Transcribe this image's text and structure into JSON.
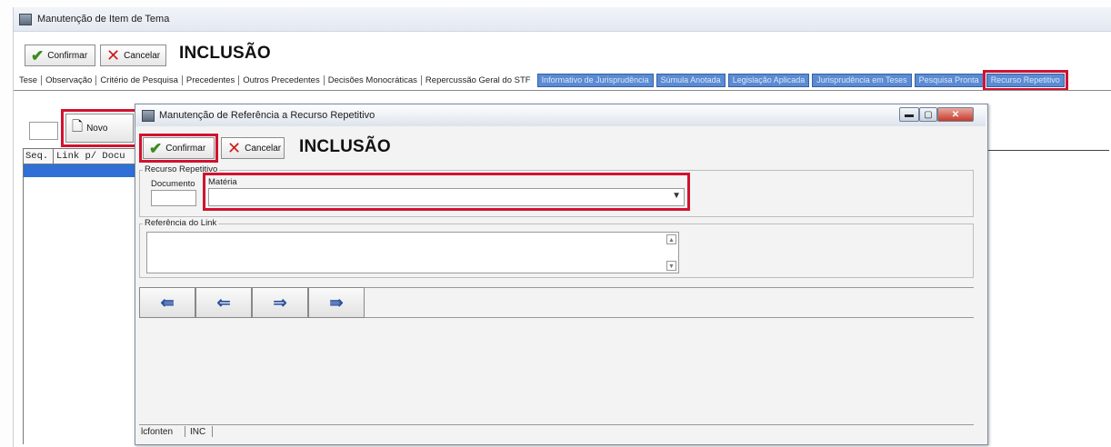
{
  "outer": {
    "title": "Manutenção de Item de Tema",
    "confirm_label": "Confirmar",
    "cancel_label": "Cancelar",
    "mode_heading": "INCLUSÃO",
    "tabs_plain": [
      "Tese",
      "Observação",
      "Critério de Pesquisa",
      "Precedentes",
      "Outros Precedentes",
      "Decisões Monocráticas",
      "Repercussão Geral do STF"
    ],
    "tabs_blue": [
      "Informativo de Jurisprudência",
      "Súmula Anotada",
      "Legislação Aplicada",
      "Jurisprudência em Teses",
      "Pesquisa Pronta",
      "Recurso Repetitivo"
    ],
    "new_button_label": "Novo",
    "grid_headers": [
      "Seq.",
      "Link p/ Docu"
    ]
  },
  "dialog": {
    "title": "Manutenção de Referência a Recurso Repetitivo",
    "confirm_label": "Confirmar",
    "cancel_label": "Cancelar",
    "mode_heading": "INCLUSÃO",
    "group_recurso": "Recurso Repetitivo",
    "label_documento": "Documento",
    "label_materia": "Matéria",
    "documento_value": "",
    "materia_value": "",
    "group_referencia": "Referência do Link",
    "referencia_value": "",
    "nav_buttons": [
      "first",
      "previous",
      "next",
      "last"
    ],
    "status": [
      "lcfonten",
      "INC",
      ""
    ]
  },
  "colors": {
    "highlight_red": "#d1122f",
    "blue_tab": "#5b8bd2",
    "selection_blue": "#2f6fd6"
  }
}
